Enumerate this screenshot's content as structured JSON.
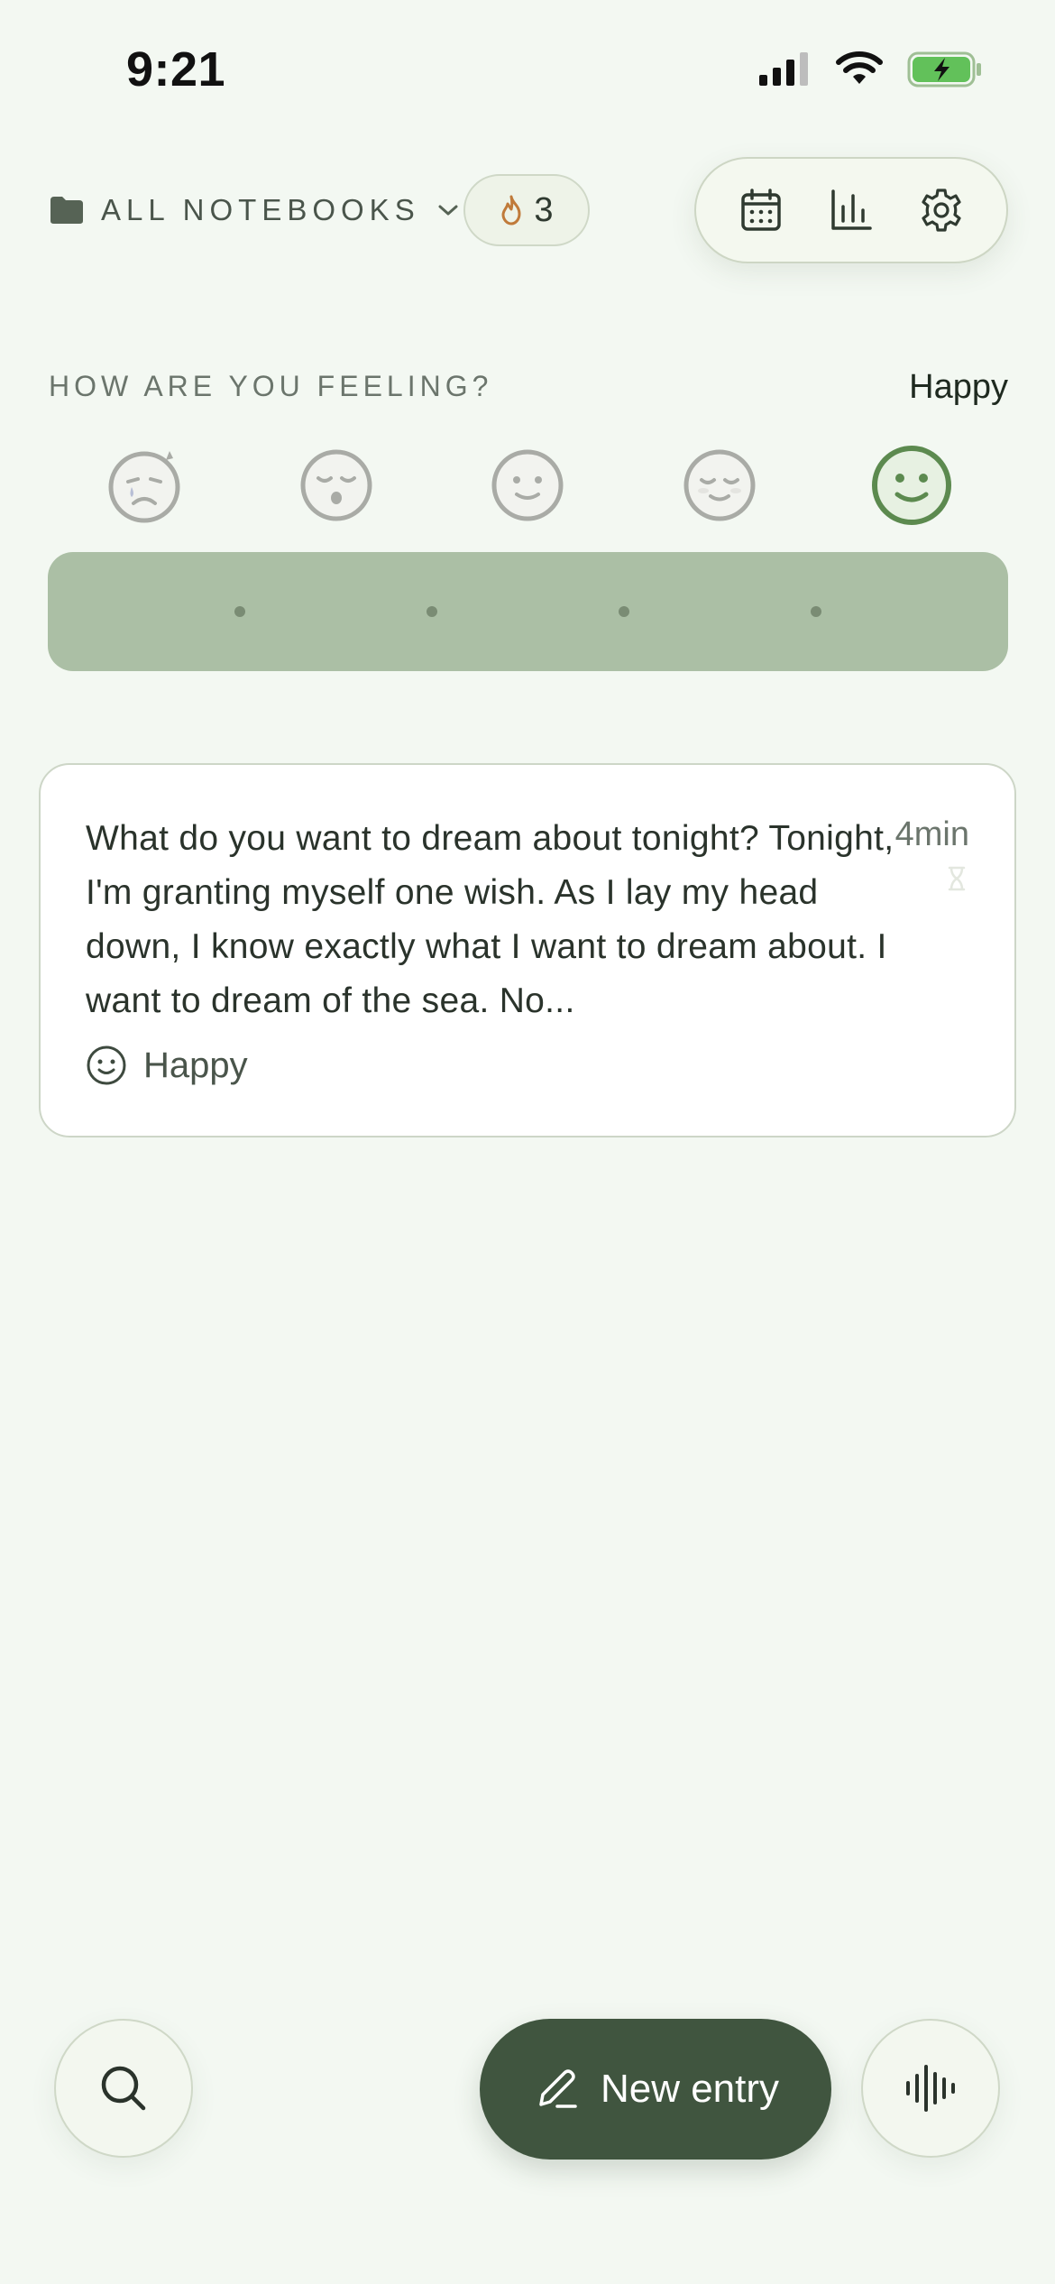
{
  "status_bar": {
    "time": "9:21"
  },
  "header": {
    "notebook_label": "ALL NOTEBOOKS",
    "streak_count": "3",
    "accent_color": "#40553f",
    "streak_flame_color": "#c07a3a"
  },
  "feeling": {
    "prompt": "HOW ARE YOU FEELING?",
    "selected": "Happy",
    "moods": [
      {
        "icon": "crying-face-icon",
        "selected": false
      },
      {
        "icon": "tired-face-icon",
        "selected": false
      },
      {
        "icon": "neutral-smile-face-icon",
        "selected": false
      },
      {
        "icon": "content-face-icon",
        "selected": false
      },
      {
        "icon": "happy-face-icon",
        "selected": true
      }
    ],
    "slider_color": "#abbfa5"
  },
  "entry": {
    "preview": "What do you want to dream about tonight? Tonight, I'm granting myself one wish. As I lay my head down, I know exactly what I want to dream about. I want to dream of the sea. No...",
    "duration": "4min",
    "mood": "Happy"
  },
  "bottom_bar": {
    "new_entry_label": "New entry"
  }
}
